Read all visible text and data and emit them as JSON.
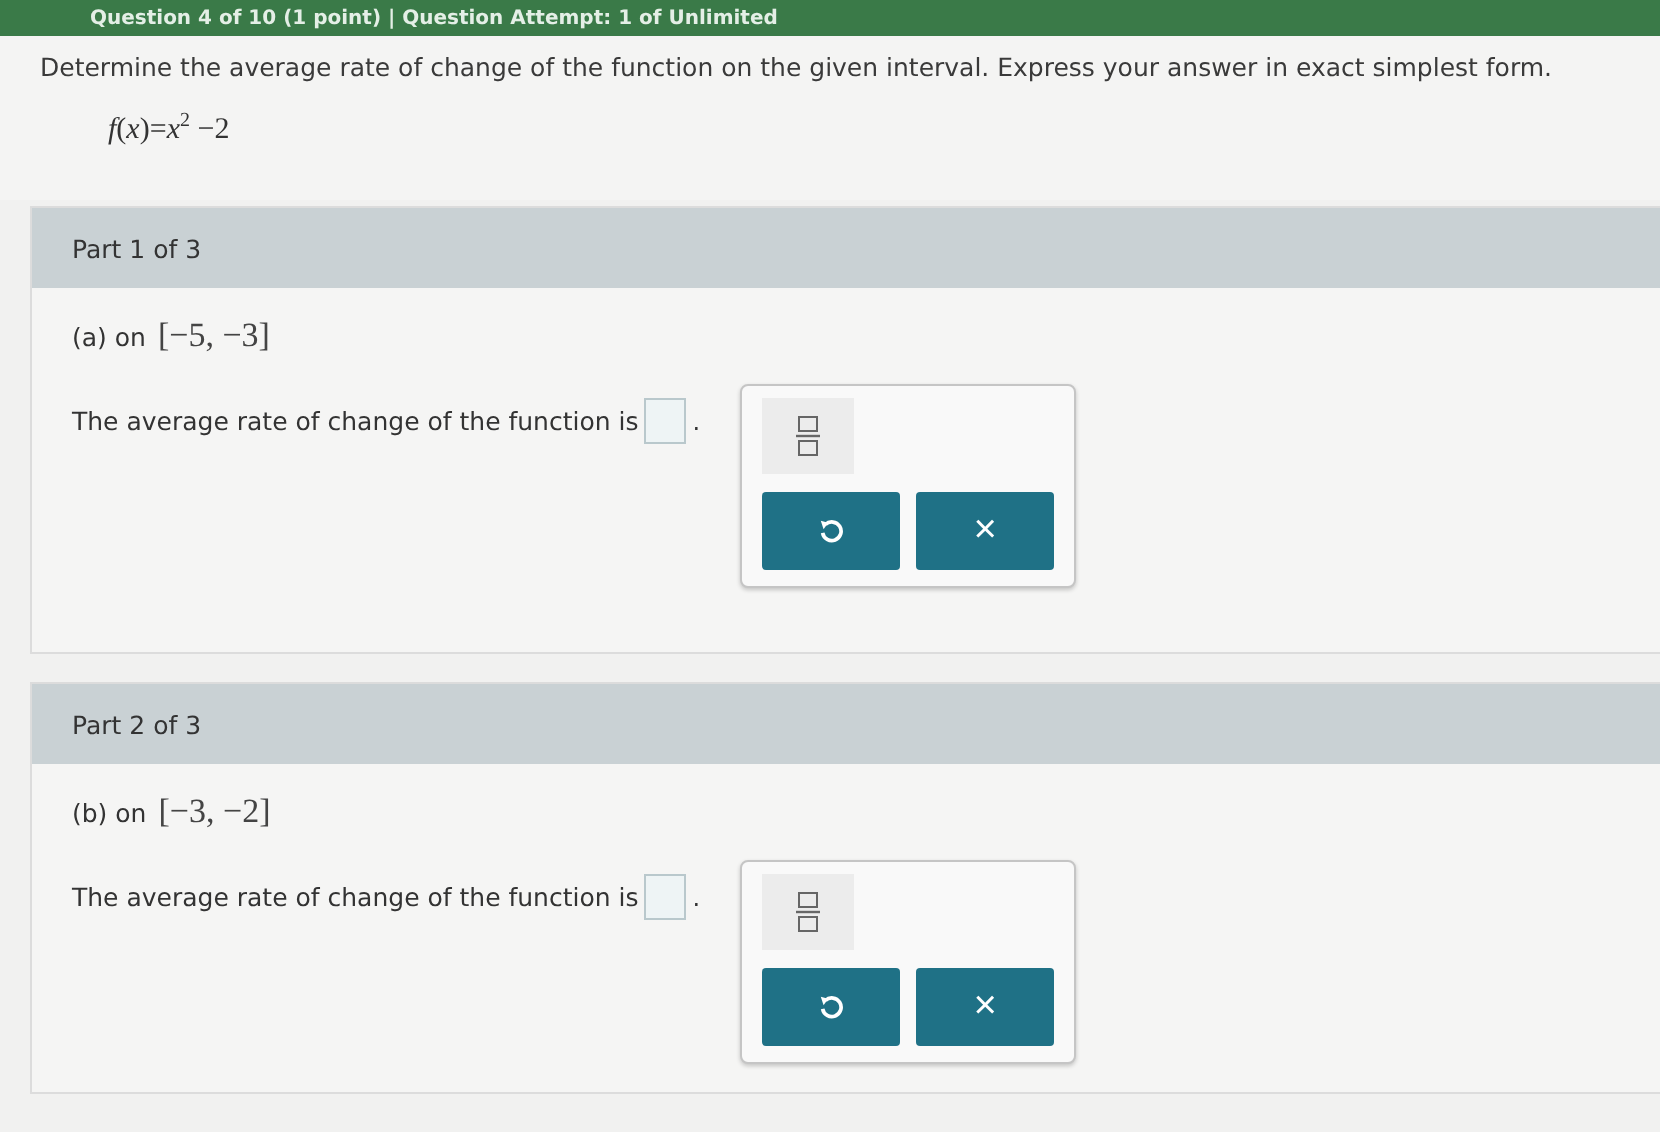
{
  "header": {
    "title": "Question 4 of 10 (1 point)  |  Question Attempt: 1 of Unlimited"
  },
  "instructions": "Determine the average rate of change of the function on the given interval. Express your answer in exact simplest form.",
  "function": "*f*(*x*)=*x*$^{2}$ −2",
  "parts": [
    {
      "title": "Part 1 of 3",
      "label": "(a) on",
      "interval": "[−5, −3]",
      "sentence": "The average rate of change of the function is",
      "period": ".",
      "clear_symbol": "×"
    },
    {
      "title": "Part 2 of 3",
      "label": "(b) on",
      "interval": "[−3, −2]",
      "sentence": "The average rate of change of the function is",
      "period": ".",
      "clear_symbol": "×"
    }
  ]
}
